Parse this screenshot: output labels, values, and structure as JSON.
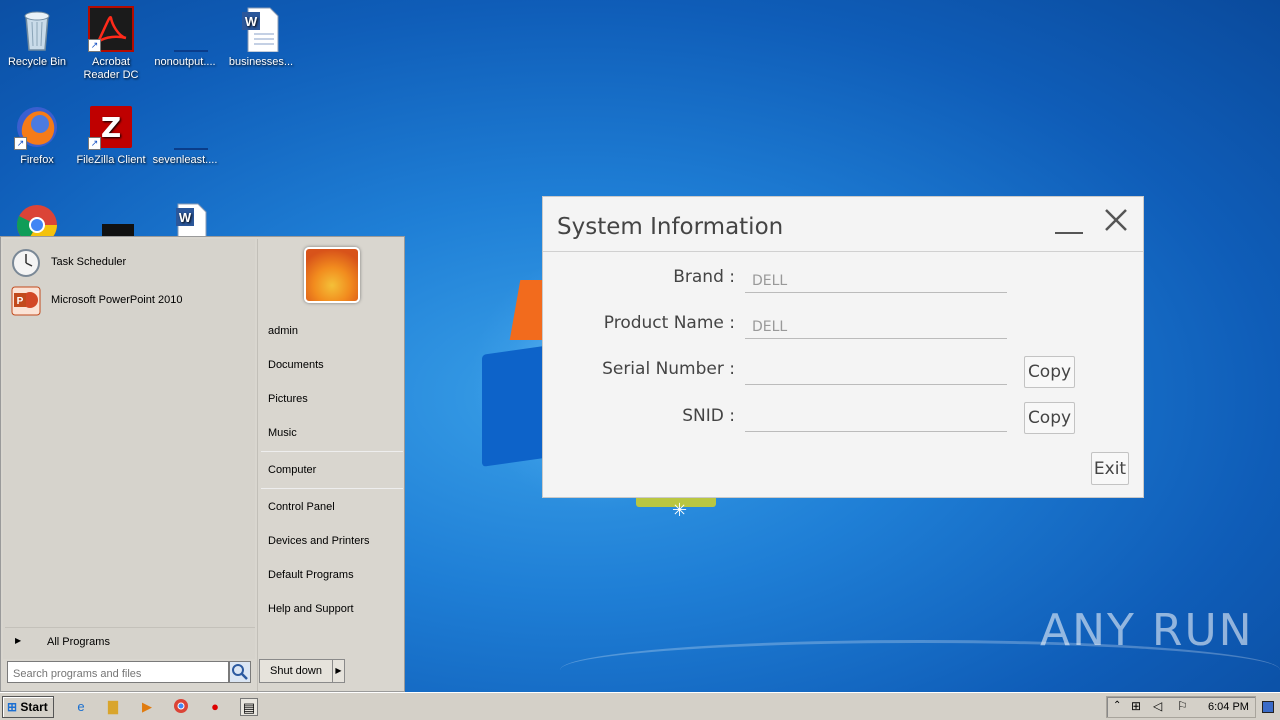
{
  "desktop": {
    "icons": [
      {
        "label": "Recycle Bin"
      },
      {
        "label": "Acrobat Reader DC"
      },
      {
        "label": "nonoutput...."
      },
      {
        "label": "businesses..."
      },
      {
        "label": "Firefox"
      },
      {
        "label": "FileZilla Client"
      },
      {
        "label": "sevenleast...."
      }
    ],
    "watermark": "ANY RUN"
  },
  "dialog": {
    "title": "System Information",
    "fields": [
      {
        "label": "Brand :",
        "value": "DELL"
      },
      {
        "label": "Product Name :",
        "value": "DELL"
      },
      {
        "label": "Serial Number :",
        "value": ""
      },
      {
        "label": "SNID :",
        "value": ""
      }
    ],
    "copy_label": "Copy",
    "exit_label": "Exit"
  },
  "start_menu": {
    "programs": [
      {
        "label": "Task Scheduler",
        "icon": "clock-icon"
      },
      {
        "label": "Microsoft PowerPoint 2010",
        "icon": "powerpoint-icon"
      }
    ],
    "all_programs": "All Programs",
    "search_placeholder": "Search programs and files",
    "right_links": [
      "admin",
      "Documents",
      "Pictures",
      "Music",
      "Computer",
      "Control Panel",
      "Devices and Printers",
      "Default Programs",
      "Help and Support"
    ],
    "shutdown": "Shut down"
  },
  "taskbar": {
    "start_label": "Start",
    "clock": "6:04 PM"
  },
  "colors": {
    "desktop_bg": "#1f7fd6",
    "dialog_bg": "#f4f4f4",
    "menu_bg": "#d9d6cf"
  }
}
